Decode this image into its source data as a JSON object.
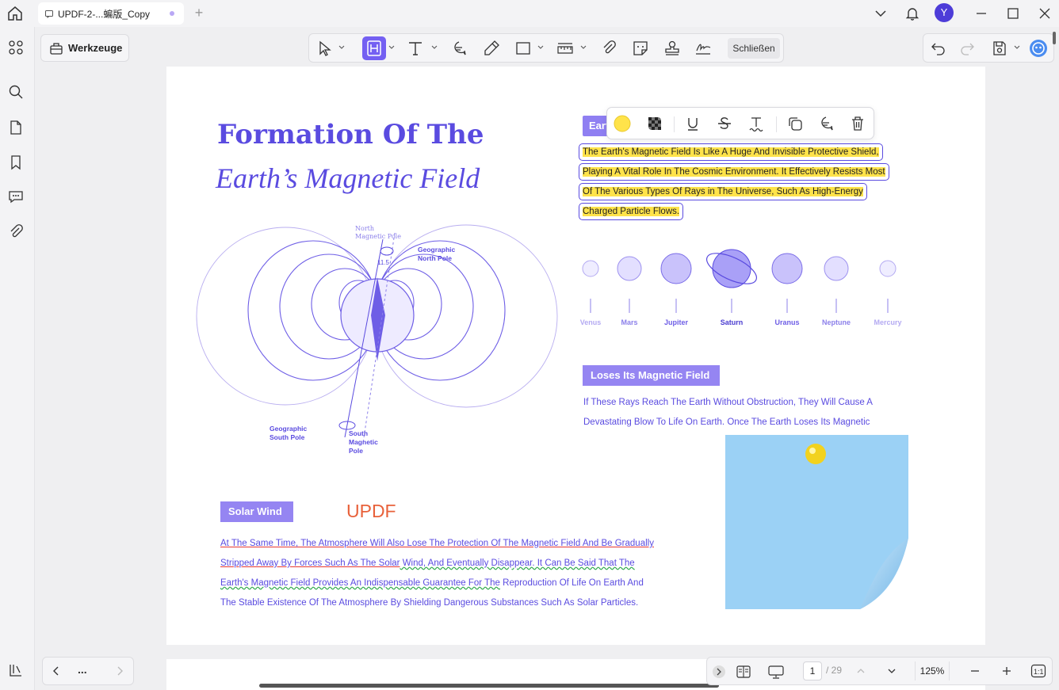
{
  "tab": {
    "title": "UPDF-2-...蝙版_Copy"
  },
  "user": {
    "avatar_letter": "Y"
  },
  "toolbar": {
    "tools_label": "Werkzeuge",
    "close_label": "Schließen"
  },
  "document": {
    "title_line1": "Formation Of The",
    "title_line2": "Earth’s Magnetic Field",
    "diagram_labels": {
      "north_magnetic": [
        "North",
        "Magnetic Pole"
      ],
      "geo_north": [
        "Geographic",
        "North Pole"
      ],
      "geo_south": [
        "Geographic",
        "South Pole"
      ],
      "south_magnetic": [
        "South",
        "Magnetic",
        "Pole"
      ],
      "angle": "11.5"
    },
    "earth_tag": "Earth",
    "highlight_lines": [
      "The Earth's Magnetic Field Is Like A Huge And Invisible Protective Shield,",
      "Playing A Vital Role In The Cosmic Environment. It Effectively Resists Most",
      "Of The Various Types Of Rays in The Universe, Such As High-Energy",
      "Charged Particle Flows."
    ],
    "planets": [
      "Venus",
      "Mars",
      "Jupiter",
      "Saturn",
      "Uranus",
      "Neptune",
      "Mercury"
    ],
    "loses_tag": "Loses Its Magnetic Field",
    "loses_text": [
      "If These Rays Reach The Earth Without Obstruction, They Will Cause A",
      "Devastating Blow To Life On Earth. Once The Earth Loses Its Magnetic"
    ],
    "solar_tag": "Solar Wind",
    "stamp_text": "UPDF",
    "solar_lines": {
      "l1": "At The Same Time, The Atmosphere Will Also Lose The Protection Of The Magnetic Field And Be Gradually",
      "l2a": "Stripped Away By Forces Such As The Solar",
      "l2b": " Wind, And Eventually Disappear. It Can Be Said That The",
      "l3a": "Earth's Magnetic Field Provides An Indispensable Guarantee For The",
      "l3b": " Reproduction Of Life On Earth And",
      "l4": "The Stable Existence Of The Atmosphere By Shielding Dangerous Substances Such As Solar Particles."
    }
  },
  "navigation": {
    "more_label": "...",
    "current_page": "1",
    "total_pages": "/ 29",
    "zoom": "125%"
  },
  "colors": {
    "accent": "#5a4be0",
    "highlight": "#ffe34a",
    "sticky": "#9bd1f5",
    "stamp": "#e8613a"
  }
}
